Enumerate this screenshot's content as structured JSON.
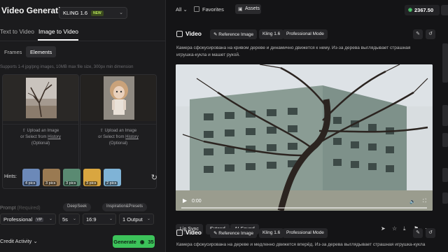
{
  "app": {
    "title": "Video Generation",
    "model": "KLING 1.6",
    "model_badge": "NEW"
  },
  "modes": [
    "Text to Video",
    "Image to Video"
  ],
  "subtabs": [
    "Frames",
    "Elements"
  ],
  "support_text": "Supports 1-4 jpg/png images, 10MB max file size, 300px min dimension",
  "frames": [
    {
      "upload": "Upload an Image",
      "or_select": "or Select from",
      "history": "History",
      "optional": "(Optional)"
    },
    {
      "upload": "Upload an Image",
      "or_select": "or Select from",
      "history": "History",
      "optional": "(Optional)"
    }
  ],
  "hints": {
    "label": "Hints:",
    "items": [
      "4 pics",
      "3 pics",
      "3 pics",
      "3 pics",
      "2 pics"
    ]
  },
  "prompt": {
    "label": "Prompt",
    "required": "(Required)",
    "deepseek": "DeepSeek",
    "inspiration": "Inspiration&Presets"
  },
  "options": {
    "mode": "Professional",
    "vip": "VIP",
    "duration": "5s",
    "ratio": "16:9",
    "outputs": "1 Output"
  },
  "footer": {
    "credit_activity": "Credit Activity",
    "generate": "Generate",
    "cost": "35"
  },
  "right_top": {
    "filter": "All",
    "favorites": "Favorites",
    "assets": "Assets",
    "credits": "2367.50"
  },
  "cards": [
    {
      "title": "Video",
      "tags": [
        "Reference Image",
        "Kling 1.6",
        "Professional Mode"
      ],
      "description": "Камера сфокусирована на кривом дереве и динамично движется к нему. Из-за дерева выглядывает страшная игрушка-кукла и машет рукой.",
      "time": "0:00",
      "actions": [
        "Lip Sync",
        "Extend",
        "AI Sound"
      ]
    },
    {
      "title": "Video",
      "tags": [
        "Reference Image",
        "Kling 1.6",
        "Professional Mode"
      ],
      "description": "Камера сфокусирована на дереве и медленно движется вперёд. Из-за дерева выглядывает страшная игрушка-кукла и"
    }
  ],
  "colors": {
    "accent_green": "#3cc35a",
    "panel": "#1b1b1d",
    "background": "#141416"
  },
  "icons": [
    "chevron-down-icon",
    "refresh-icon",
    "assets-icon",
    "coin-icon",
    "video-icon",
    "edit-icon",
    "history-icon",
    "play-icon",
    "volume-icon",
    "fullscreen-icon",
    "share-icon",
    "star-icon",
    "download-icon",
    "flag-icon",
    "more-icon"
  ]
}
